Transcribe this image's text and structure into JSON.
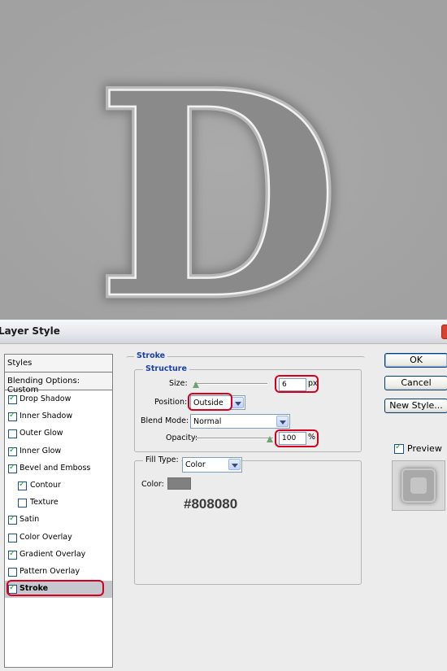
{
  "dialog": {
    "title": "Layer Style"
  },
  "styles_panel": {
    "header": "Styles",
    "blending": "Blending Options: Custom",
    "items": [
      {
        "label": "Drop Shadow",
        "checked": true,
        "indent": false,
        "selected": false
      },
      {
        "label": "Inner Shadow",
        "checked": true,
        "indent": false,
        "selected": false
      },
      {
        "label": "Outer Glow",
        "checked": false,
        "indent": false,
        "selected": false
      },
      {
        "label": "Inner Glow",
        "checked": true,
        "indent": false,
        "selected": false
      },
      {
        "label": "Bevel and Emboss",
        "checked": true,
        "indent": false,
        "selected": false
      },
      {
        "label": "Contour",
        "checked": true,
        "indent": true,
        "selected": false
      },
      {
        "label": "Texture",
        "checked": false,
        "indent": true,
        "selected": false
      },
      {
        "label": "Satin",
        "checked": true,
        "indent": false,
        "selected": false
      },
      {
        "label": "Color Overlay",
        "checked": false,
        "indent": false,
        "selected": false
      },
      {
        "label": "Gradient Overlay",
        "checked": true,
        "indent": false,
        "selected": false
      },
      {
        "label": "Pattern Overlay",
        "checked": false,
        "indent": false,
        "selected": false
      },
      {
        "label": "Stroke",
        "checked": true,
        "indent": false,
        "selected": true
      }
    ]
  },
  "stroke": {
    "section_title": "Stroke",
    "structure_title": "Structure",
    "size_label": "Size:",
    "size_value": "6",
    "size_unit": "px",
    "position_label": "Position:",
    "position_value": "Outside",
    "blend_label": "Blend Mode:",
    "blend_value": "Normal",
    "opacity_label": "Opacity:",
    "opacity_value": "100",
    "opacity_unit": "%",
    "fill_type_label": "Fill Type:",
    "fill_type_value": "Color",
    "color_label": "Color:",
    "color_hex": "#808080"
  },
  "buttons": {
    "ok": "OK",
    "cancel": "Cancel",
    "new_style": "New Style...",
    "preview_label": "Preview"
  },
  "canvas": {
    "letter": "D"
  },
  "colors": {
    "highlight": "#d3001d",
    "stroke_swatch": "#808080",
    "canvas_bg": "#a3a3a3"
  }
}
